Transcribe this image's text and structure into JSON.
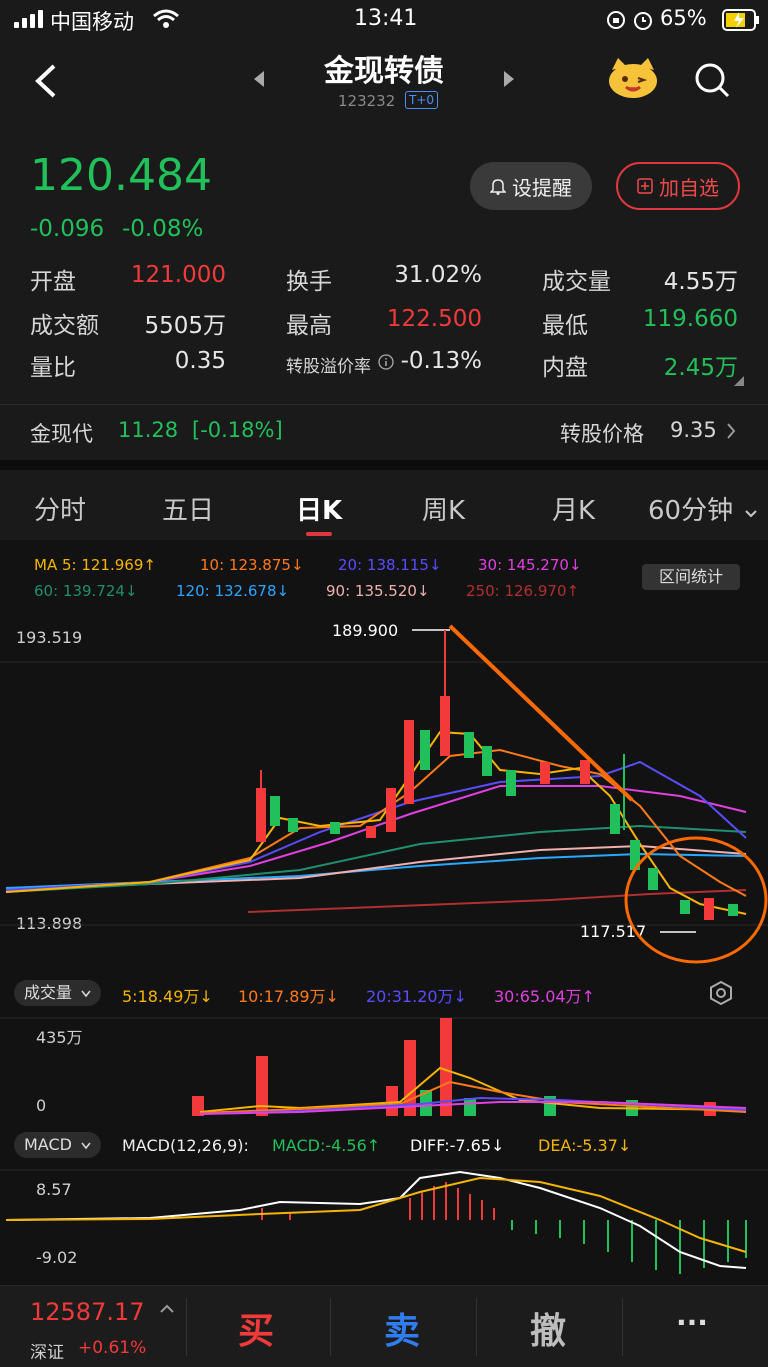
{
  "status_bar": {
    "carrier": "中国移动",
    "time": "13:41",
    "battery": "65%"
  },
  "header": {
    "title": "金现转债",
    "code": "123232",
    "badge": "T+0"
  },
  "quote": {
    "price": "120.484",
    "change": "-0.096",
    "change_pct": "-0.08%",
    "alert_label": "设提醒",
    "watch_label": "加自选",
    "fields": [
      {
        "label": "开盘",
        "value": "121.000",
        "color": "#f23a3a"
      },
      {
        "label": "换手",
        "value": "31.02%",
        "color": "#e6e6e6"
      },
      {
        "label": "成交量",
        "value": "4.55万",
        "color": "#e6e6e6"
      },
      {
        "label": "成交额",
        "value": "5505万",
        "color": "#e6e6e6"
      },
      {
        "label": "最高",
        "value": "122.500",
        "color": "#f23a3a"
      },
      {
        "label": "最低",
        "value": "119.660",
        "color": "#22c05a"
      },
      {
        "label": "量比",
        "value": "0.35",
        "color": "#e6e6e6"
      },
      {
        "label": "转股溢价率",
        "value": "-0.13%",
        "color": "#e6e6e6"
      },
      {
        "label": "内盘",
        "value": "2.45万",
        "color": "#22c05a"
      }
    ],
    "stock_name": "金现代",
    "stock_price": "11.28",
    "stock_pct": "[-0.18%]",
    "conv_label": "转股价格",
    "conv_value": "9.35"
  },
  "tabs": [
    "分时",
    "五日",
    "日K",
    "周K",
    "月K",
    "60分钟"
  ],
  "active_tab": "日K",
  "ma": {
    "row1": [
      {
        "text": "MA 5: 121.969↑",
        "color": "#f5b400"
      },
      {
        "text": "10: 123.875↓",
        "color": "#ff7a1a"
      },
      {
        "text": "20: 138.115↓",
        "color": "#5a4cff"
      },
      {
        "text": "30: 145.270↓",
        "color": "#e040e0"
      }
    ],
    "row2": [
      {
        "text": "60: 139.724↓",
        "color": "#1f8f6e"
      },
      {
        "text": "120: 132.678↓",
        "color": "#2aa8ff"
      },
      {
        "text": "90: 135.520↓",
        "color": "#f0b0b0"
      },
      {
        "text": "250: 126.970↑",
        "color": "#b03030"
      }
    ],
    "range_label": "区间统计"
  },
  "kline": {
    "y_top": "193.519",
    "y_bottom": "113.898",
    "max_label": "189.900",
    "min_label": "117.517"
  },
  "volume": {
    "dropdown": "成交量",
    "items": [
      {
        "text": "5:18.49万↓",
        "color": "#f5b400"
      },
      {
        "text": "10:17.89万↓",
        "color": "#ff7a1a"
      },
      {
        "text": "20:31.20万↓",
        "color": "#5a4cff"
      },
      {
        "text": "30:65.04万↑",
        "color": "#e040e0"
      }
    ],
    "y_top": "435万",
    "y_bottom": "0"
  },
  "macd": {
    "dropdown": "MACD",
    "params": "MACD(12,26,9):",
    "items": [
      {
        "text": "MACD:-4.56↑",
        "color": "#22c05a"
      },
      {
        "text": "DIFF:-7.65↓",
        "color": "#ffffff"
      },
      {
        "text": "DEA:-5.37↓",
        "color": "#f5b400"
      }
    ],
    "y_top": "8.57",
    "y_bottom": "-9.02"
  },
  "bottom": {
    "index_value": "12587.17",
    "index_name": "深证",
    "index_pct": "+0.61%",
    "buy": "买",
    "sell": "卖",
    "cancel": "撤",
    "more": "···"
  },
  "colors": {
    "up": "#f23a3a",
    "down": "#22c05a",
    "accent_orange": "#ff6a00"
  }
}
